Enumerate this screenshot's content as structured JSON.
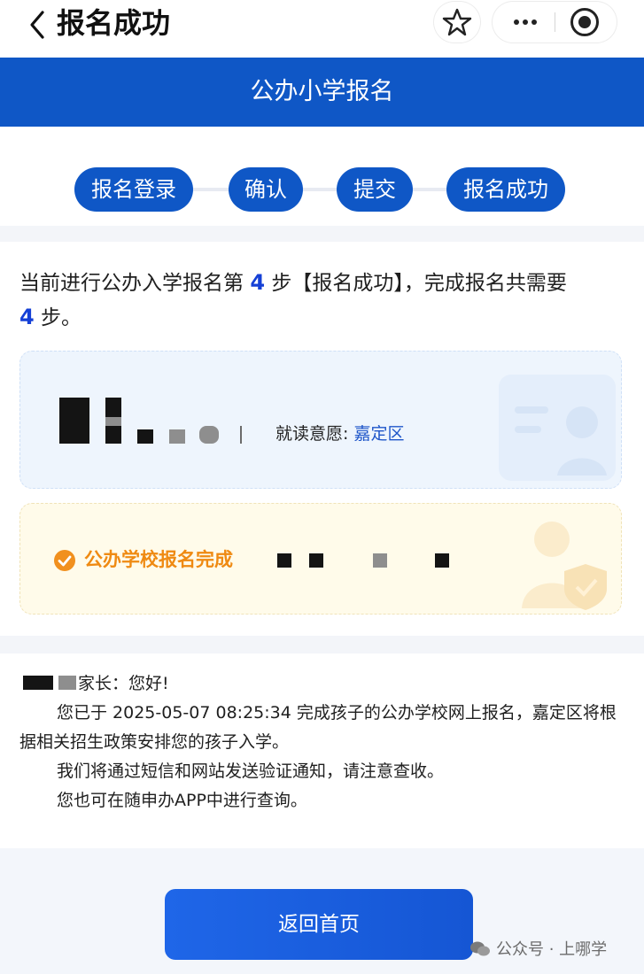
{
  "topbar": {
    "title": "报名成功"
  },
  "header": {
    "title": "公办小学报名"
  },
  "steps": [
    {
      "label": "报名登录"
    },
    {
      "label": "确认"
    },
    {
      "label": "提交"
    },
    {
      "label": "报名成功"
    }
  ],
  "progress": {
    "prefix": "当前进行公办入学报名第",
    "current_step": "4",
    "middle": "步【报名成功】，完成报名共需要",
    "total_steps": "4",
    "suffix": "步。"
  },
  "student_card": {
    "wish_label": "就读意愿:",
    "wish_value": "嘉定区"
  },
  "status_card": {
    "status_text": "公办学校报名完成"
  },
  "notice": {
    "greeting": "家长：您好!",
    "line1": "您已于 2025-05-07 08:25:34 完成孩子的公办学校网上报名，嘉定区将根据相关招生政策安排您的孩子入学。",
    "line2": "我们将通过短信和网站发送验证通知，请注意查收。",
    "line3": "您也可在随申办APP中进行查询。"
  },
  "footer": {
    "home_button_label": "返回首页",
    "watermark_text": "公众号 · 上哪学"
  },
  "colors": {
    "primary_blue": "#0f57c6",
    "accent_orange": "#ef8a12",
    "number_blue": "#1540d6"
  },
  "icons": [
    "back-chevron-icon",
    "star-icon",
    "more-dots-icon",
    "close-target-icon",
    "check-circle-icon",
    "wechat-icon"
  ]
}
